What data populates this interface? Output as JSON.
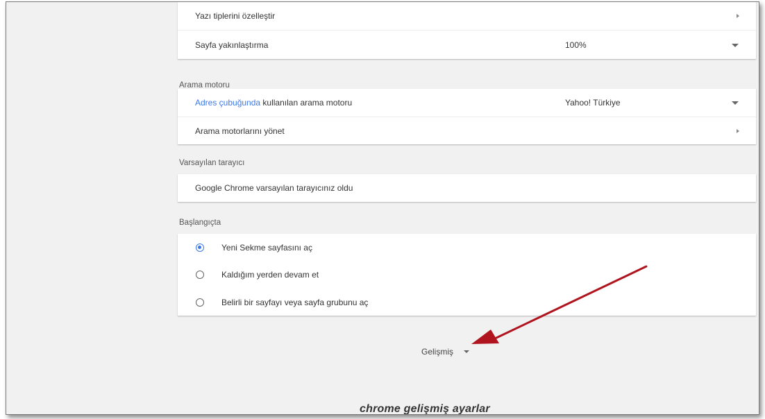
{
  "appearance": {
    "font_customize_label": "Yazı tiplerini özelleştir",
    "page_zoom_label": "Sayfa yakınlaştırma",
    "page_zoom_value": "100%"
  },
  "search_engine": {
    "section_title": "Arama motoru",
    "address_bar_link": "Adres çubuğunda",
    "address_bar_rest": " kullanılan arama motoru",
    "selected_engine": "Yahoo! Türkiye",
    "manage_label": "Arama motorlarını yönet"
  },
  "default_browser": {
    "section_title": "Varsayılan tarayıcı",
    "status_text": "Google Chrome varsayılan tarayıcınız oldu"
  },
  "startup": {
    "section_title": "Başlangıçta",
    "options": [
      {
        "label": "Yeni Sekme sayfasını aç",
        "checked": true
      },
      {
        "label": "Kaldığım yerden devam et",
        "checked": false
      },
      {
        "label": "Belirli bir sayfayı veya sayfa grubunu aç",
        "checked": false
      }
    ]
  },
  "advanced": {
    "label": "Gelişmiş"
  },
  "annotation": {
    "arrow_color": "#b0141e",
    "caption": "chrome gelişmiş ayarlar"
  },
  "colors": {
    "accent": "#3b78e7",
    "background": "#f1f1f1"
  }
}
